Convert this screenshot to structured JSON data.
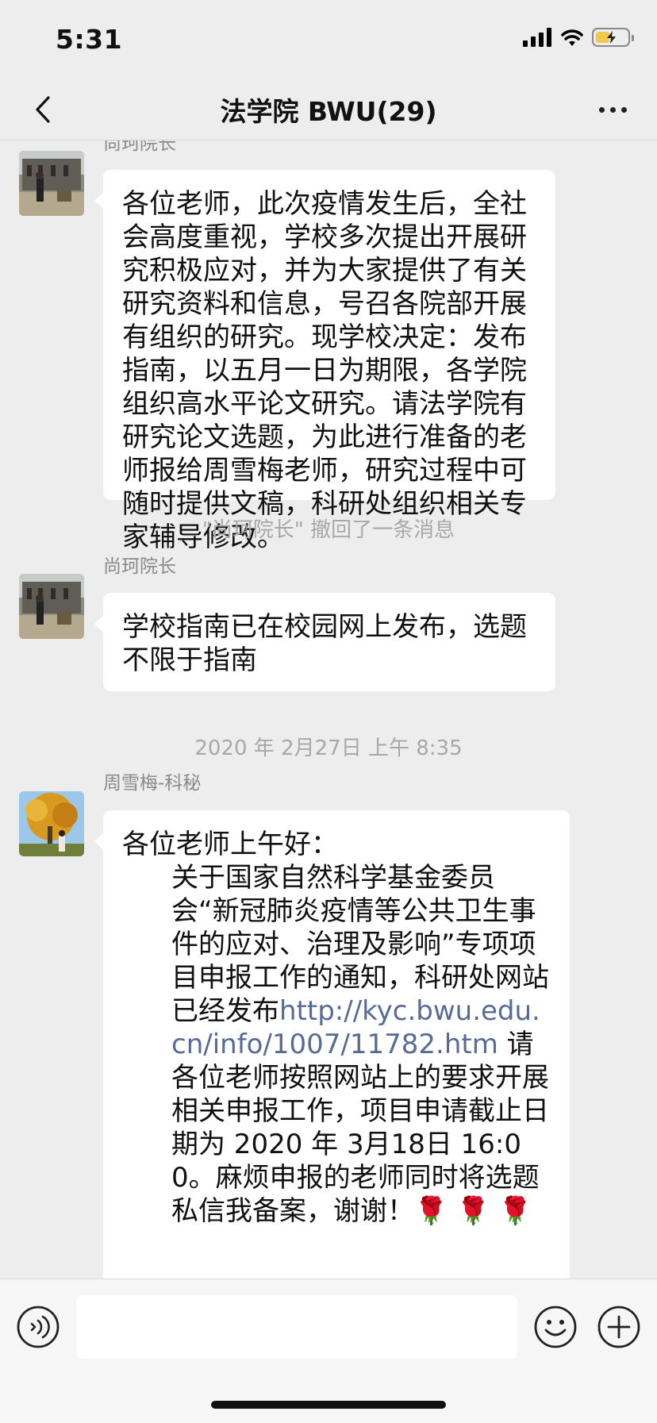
{
  "status_bar": {
    "time": "5:31",
    "icons": [
      "cellular-signal-icon",
      "wifi-icon",
      "battery-charging-icon"
    ]
  },
  "nav": {
    "title": "法学院 BWU(29)",
    "back_icon": "chevron-left-icon",
    "more_icon": "more-dots-icon"
  },
  "messages": [
    {
      "sender": "尚珂院长",
      "text": "各位老师，此次疫情发生后，全社会高度重视，学校多次提出开展研究积极应对，并为大家提供了有关研究资料和信息，号召各院部开展有组织的研究。现学校决定：发布指南，以五月一日为期限，各学院组织高水平论文研究。请法学院有研究论文选题，为此进行准备的老师报给周雪梅老师，研究过程中可随时提供文稿，科研处组织相关专家辅导修改。"
    },
    {
      "system": "\"尚珂院长\" 撤回了一条消息"
    },
    {
      "sender": "尚珂院长",
      "text": "学校指南已在校园网上发布，选题不限于指南"
    },
    {
      "timestamp": "2020 年 2月27日 上午 8:35"
    },
    {
      "sender": "周雪梅-科秘",
      "greeting": "各位老师上午好：",
      "text_before_link": "关于国家自然科学基金委员会“新冠肺炎疫情等公共卫生事件的应对、治理及影响”专项项目申报工作的通知，科研处网站已经发布",
      "link": "http://kyc.bwu.edu.cn/info/1007/11782.htm",
      "text_after_link": " 请各位老师按照网站上的要求开展相关申报工作，项目申请截止日期为 2020 年 3月18日 16:00。麻烦申报的老师同时将选题私信我备案，谢谢！",
      "emoji": "🌹 🌹 🌹"
    }
  ],
  "input_bar": {
    "voice_icon": "voice-icon",
    "placeholder": "",
    "emoji_icon": "emoji-icon",
    "add_icon": "plus-circle-icon"
  },
  "colors": {
    "background": "#ededed",
    "bubble": "#ffffff",
    "link": "#576b95",
    "secondary_text": "#8a8a8a"
  }
}
